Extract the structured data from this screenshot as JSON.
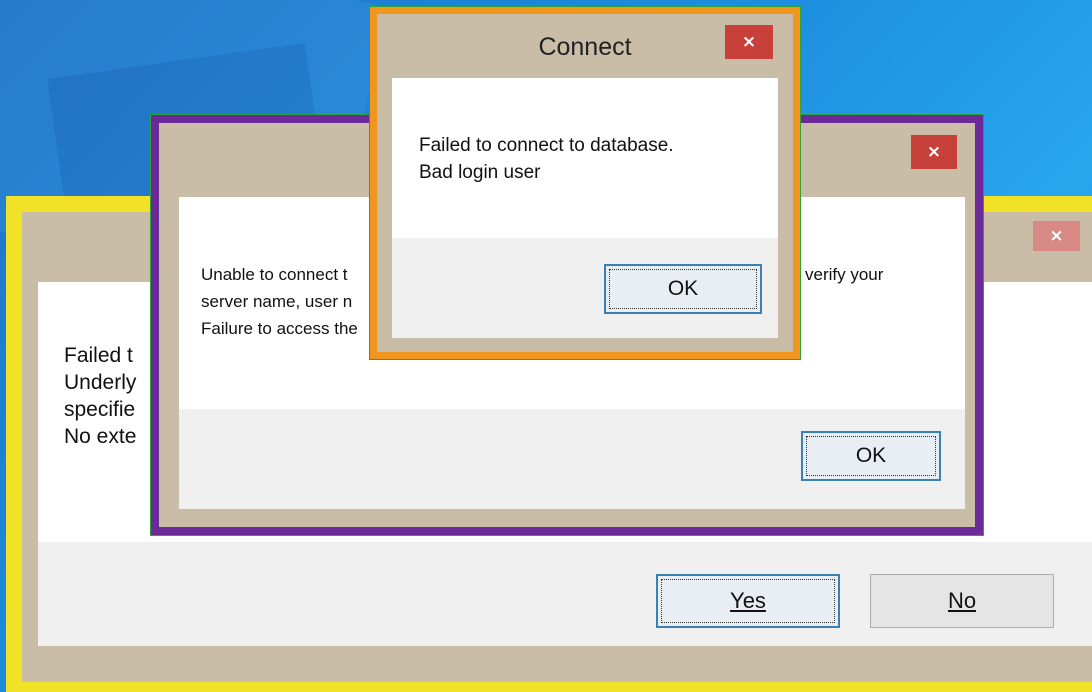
{
  "dialog_back": {
    "message_lines": "Failed t\nUnderly\nspecifie\nNo exte",
    "yes_label": "Yes",
    "no_label": "No",
    "close_glyph": "×"
  },
  "dialog_middle": {
    "message_left": "Unable to connect t\nserver name, user n\nFailure to access the",
    "message_right": "verify your",
    "ok_label": "OK",
    "close_glyph": "×"
  },
  "dialog_front": {
    "title": "Connect",
    "message": "Failed to connect to database.\nBad login user",
    "ok_label": "OK",
    "close_glyph": "×"
  },
  "colors": {
    "back_frame": "#f2e227",
    "middle_frame": "#6b2a98",
    "front_frame": "#f0961e",
    "close_red": "#c7403a"
  }
}
